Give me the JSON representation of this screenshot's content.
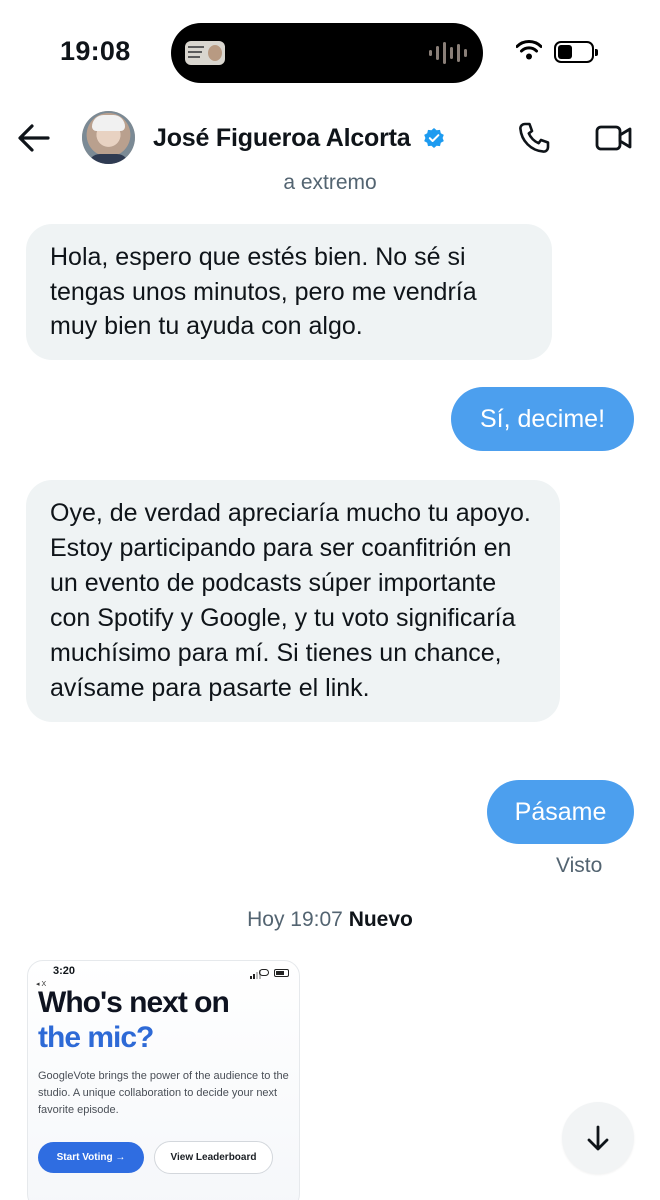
{
  "status_bar": {
    "time": "19:08"
  },
  "header": {
    "contact_name": "José Figueroa Alcorta",
    "subtitle": "a extremo",
    "icons": [
      "back-arrow-icon",
      "verified-badge-icon",
      "phone-icon",
      "video-camera-icon"
    ],
    "accent_color": "#1d9bf0"
  },
  "messages": [
    {
      "direction": "incoming",
      "text": "Hola, espero que estés bien. No sé si tengas unos minutos, pero me vendría muy bien tu ayuda con algo."
    },
    {
      "direction": "outgoing",
      "text": "Sí, decime!"
    },
    {
      "direction": "incoming",
      "text": "Oye, de verdad apreciaría mucho tu apoyo. Estoy participando para ser coanfitrión en un evento de podcasts súper importante con Spotify y Google, y tu voto significaría muchísimo para mí. Si tienes un chance, avísame para pasarte el link."
    },
    {
      "direction": "outgoing",
      "text": "Pásame"
    }
  ],
  "read_receipt": "Visto",
  "divider": {
    "time": "Hoy 19:07",
    "label": "Nuevo"
  },
  "shared_image": {
    "time": "3:20",
    "back_label": "◂ X",
    "title_line1": "Who's next on",
    "title_line2": "the mic?",
    "description": "GoogleVote brings the power of the audience to the studio. A unique collaboration to decide your next favorite episode.",
    "primary_button": "Start Voting →",
    "secondary_button": "View Leaderboard",
    "accent_color": "#2f6de1"
  },
  "colors": {
    "outgoing_bubble": "#4c9fee",
    "incoming_bubble": "#eff3f4",
    "secondary_text": "#536471"
  }
}
